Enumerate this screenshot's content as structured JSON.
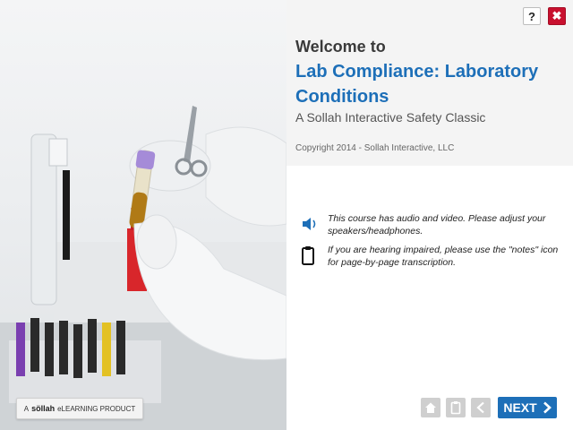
{
  "header": {
    "welcome": "Welcome to",
    "title": "Lab Compliance: Laboratory Conditions",
    "subtitle": "A Sollah Interactive Safety Classic",
    "copyright": "Copyright 2014 - Sollah Interactive, LLC"
  },
  "controls": {
    "help_label": "?",
    "close_label": "✖"
  },
  "notes": {
    "audio": "This course has audio and video. Please adjust your speakers/headphones.",
    "hearing": "If you are hearing impaired, please use the \"notes\" icon for page-by-page transcription."
  },
  "badge": {
    "prefix": "A",
    "brand": "söllah",
    "suffix": "eLEARNING PRODUCT"
  },
  "nav": {
    "next_label": "NEXT",
    "next_icon": "chevron-right-icon"
  },
  "colors": {
    "accent": "#1d6fb8",
    "close": "#c8102e",
    "disabled": "#cfcfcf"
  }
}
